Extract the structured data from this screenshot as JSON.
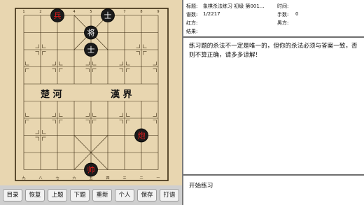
{
  "board": {
    "river_left": "楚 河",
    "river_right": "漢 界",
    "top_numbers": [
      "1",
      "2",
      "3",
      "4",
      "5",
      "6",
      "7",
      "8",
      "9"
    ],
    "bottom_numbers": [
      "九",
      "八",
      "七",
      "六",
      "五",
      "四",
      "三",
      "二",
      "一"
    ],
    "pieces": [
      {
        "id": "black-shi-top",
        "char": "士",
        "color": "black"
      },
      {
        "id": "red-bing",
        "char": "兵",
        "color": "red"
      },
      {
        "id": "black-jiang",
        "char": "将",
        "color": "black"
      },
      {
        "id": "black-shi-mid",
        "char": "士",
        "color": "black"
      },
      {
        "id": "red-pao",
        "char": "炮",
        "color": "red"
      },
      {
        "id": "red-shuai",
        "char": "帅",
        "color": "red"
      }
    ]
  },
  "toolbar": {
    "buttons": [
      "目录",
      "恢复",
      "上题",
      "下题",
      "重新",
      "个人",
      "保存",
      "打谱"
    ]
  },
  "info": {
    "title_label": "标题:",
    "title_value": "象棋杀法练习 初级 第001...",
    "time_label": "时间:",
    "time_value": "",
    "spectrum_label": "谱数:",
    "spectrum_value": "1/2217",
    "moves_label": "手数:",
    "moves_value": "0",
    "red_label": "红方:",
    "red_value": "",
    "black_label": "黑方:",
    "black_value": "",
    "result_label": "结果:",
    "result_value": ""
  },
  "message": "练习题的杀法不一定是唯一的，但你的杀法必须与答案一致，否则不算正确，请多多谅解！",
  "start_label": "开始练习"
}
